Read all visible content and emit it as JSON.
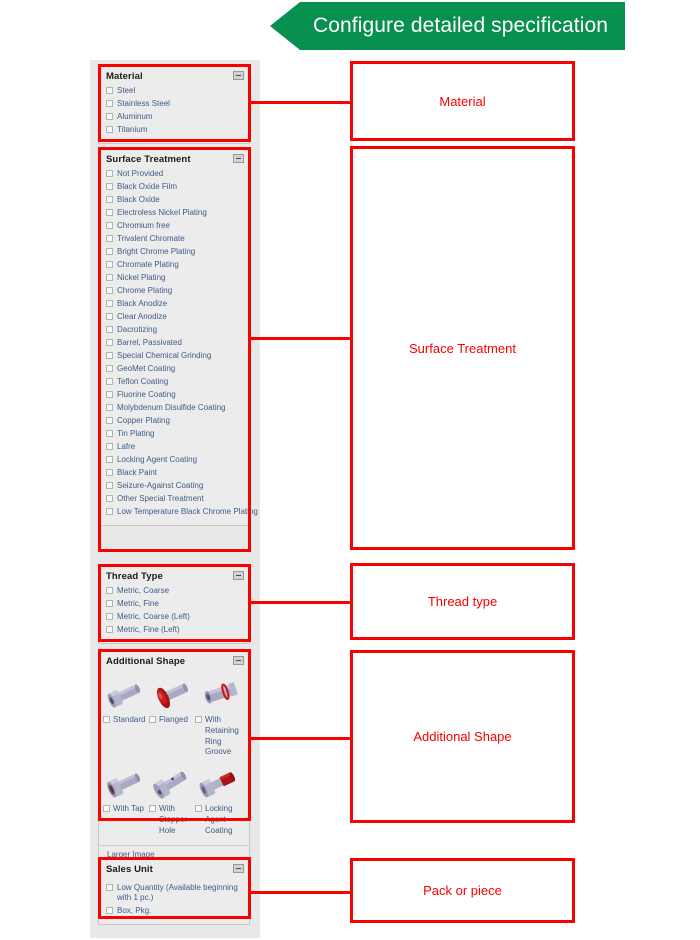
{
  "banner": {
    "title": "Configure detailed specification",
    "color": "#089051"
  },
  "accent": {
    "highlight": "#fb0000",
    "link": "#3f5c88",
    "panel_bg": "#ececec"
  },
  "panels": [
    {
      "id": "material",
      "title": "Material",
      "collapse_icon": "minus-icon",
      "options": [
        "Steel",
        "Stainless Steel",
        "Aluminum",
        "Titanium"
      ]
    },
    {
      "id": "surface-treatment",
      "title": "Surface Treatment",
      "collapse_icon": "minus-icon",
      "options": [
        "Not Provided",
        "Black Oxide Film",
        "Black Oxide",
        "Electroless Nickel Plating",
        "Chromium free",
        "Trivalent Chromate",
        "Bright Chrome Plating",
        "Chromate Plating",
        "Nickel Plating",
        "Chrome Plating",
        "Black Anodize",
        "Clear Anodize",
        "Dacrotizing",
        "Barrel, Passivated",
        "Special Chemical Grinding",
        "GeoMet Coating",
        "Teflon Coating",
        "Fluorine Coating",
        "Molybdenum Disulfide Coating",
        "Copper Plating",
        "Tin Plating",
        "Lafre",
        "Locking Agent Coating",
        "Black Paint",
        "Seizure-Against Coating",
        "Other Special Treatment",
        "Low Temperature Black Chrome Plating"
      ]
    },
    {
      "id": "thread-type",
      "title": "Thread Type",
      "collapse_icon": "minus-icon",
      "options": [
        "Metric, Coarse",
        "Metric, Fine",
        "Metric, Coarse (Left)",
        "Metric, Fine (Left)"
      ]
    },
    {
      "id": "additional-shape",
      "title": "Additional Shape",
      "collapse_icon": "minus-icon",
      "larger_image_label": "Larger Image",
      "shapes": [
        {
          "label": "Standard",
          "icon": "bolt-standard-icon"
        },
        {
          "label": "Flanged",
          "icon": "bolt-flanged-icon"
        },
        {
          "label": "With Retaining Ring Groove",
          "icon": "bolt-retaining-ring-icon"
        },
        {
          "label": "With Tap",
          "icon": "bolt-with-tap-icon"
        },
        {
          "label": "With Stopper Hole",
          "icon": "bolt-stopper-hole-icon"
        },
        {
          "label": "Locking Agent Coating",
          "icon": "bolt-locking-agent-icon"
        }
      ]
    },
    {
      "id": "sales-unit",
      "title": "Sales Unit",
      "collapse_icon": "minus-icon",
      "options": [
        "Low Quantity (Available beginning with 1 pc.)",
        "Box, Pkg."
      ]
    }
  ],
  "annotations": [
    {
      "id": "material",
      "label": "Material"
    },
    {
      "id": "surface-treatment",
      "label": "Surface Treatment"
    },
    {
      "id": "thread-type",
      "label": "Thread type"
    },
    {
      "id": "additional-shape",
      "label": "Additional Shape"
    },
    {
      "id": "sales-unit",
      "label": "Pack or piece"
    }
  ]
}
